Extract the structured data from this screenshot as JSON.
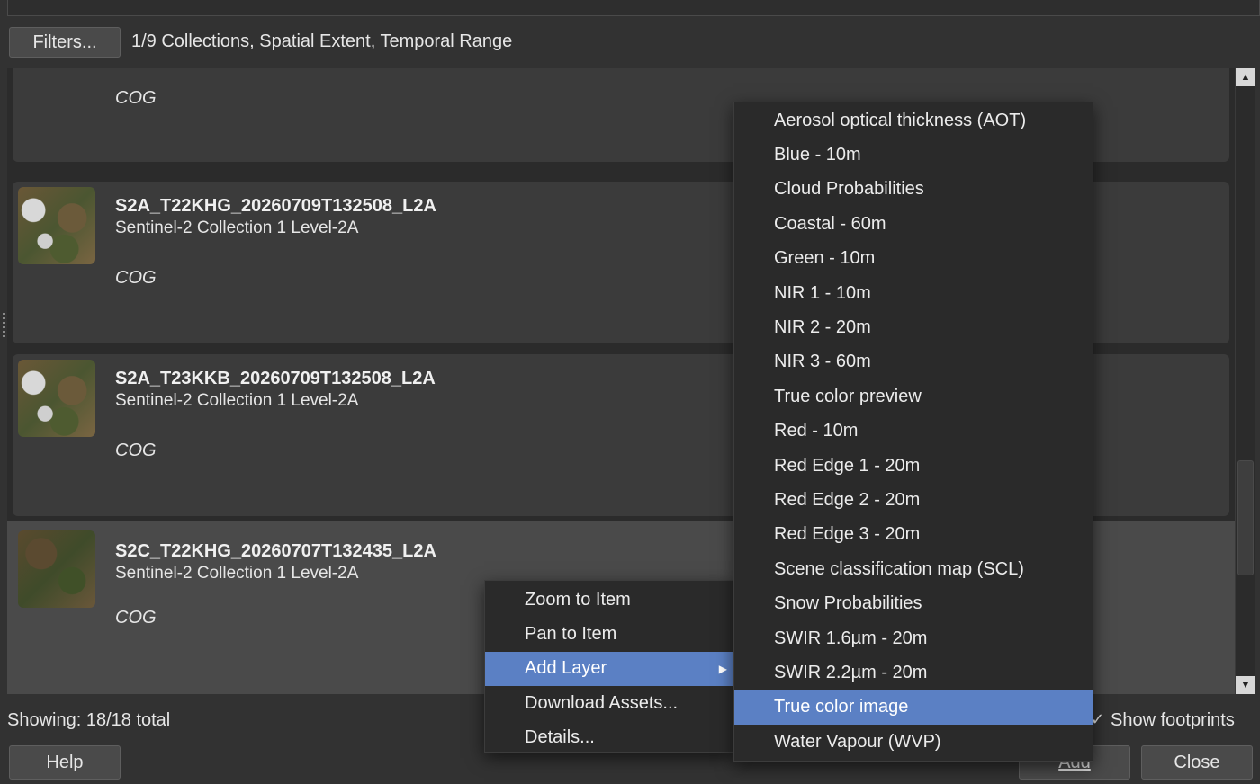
{
  "toolbar": {
    "filters_label": "Filters...",
    "filter_summary": "1/9 Collections, Spatial Extent, Temporal Range"
  },
  "items": [
    {
      "title": "",
      "subtitle": "",
      "format": "COG"
    },
    {
      "title": "S2A_T22KHG_20260709T132508_L2A",
      "subtitle": "Sentinel-2 Collection 1 Level-2A",
      "format": "COG"
    },
    {
      "title": "S2A_T23KKB_20260709T132508_L2A",
      "subtitle": "Sentinel-2 Collection 1 Level-2A",
      "format": "COG"
    },
    {
      "title": "S2C_T22KHG_20260707T132435_L2A",
      "subtitle": "Sentinel-2 Collection 1 Level-2A",
      "format": "COG"
    }
  ],
  "footer": {
    "showing": "Showing: 18/18 total",
    "show_footprints": "Show footprints",
    "help_label": "Help",
    "add_label": "Add",
    "close_label": "Close"
  },
  "context_menu": {
    "items": [
      "Zoom to Item",
      "Pan to Item",
      "Add Layer",
      "Download Assets...",
      "Details..."
    ],
    "highlighted": "Add Layer"
  },
  "assets_menu": {
    "items": [
      "Aerosol optical thickness (AOT)",
      "Blue - 10m",
      "Cloud Probabilities",
      "Coastal - 60m",
      "Green - 10m",
      "NIR 1 - 10m",
      "NIR 2 - 20m",
      "NIR 3 - 60m",
      "True color preview",
      "Red - 10m",
      "Red Edge 1 - 20m",
      "Red Edge 2 - 20m",
      "Red Edge 3 - 20m",
      "Scene classification map (SCL)",
      "Snow Probabilities",
      "SWIR 1.6µm - 20m",
      "SWIR 2.2µm - 20m",
      "True color image",
      "Water Vapour (WVP)"
    ],
    "highlighted": "True color image"
  },
  "icons": {
    "scroll_up": "▲",
    "scroll_down": "▼",
    "submenu": "▶",
    "checkmark": "✓"
  }
}
